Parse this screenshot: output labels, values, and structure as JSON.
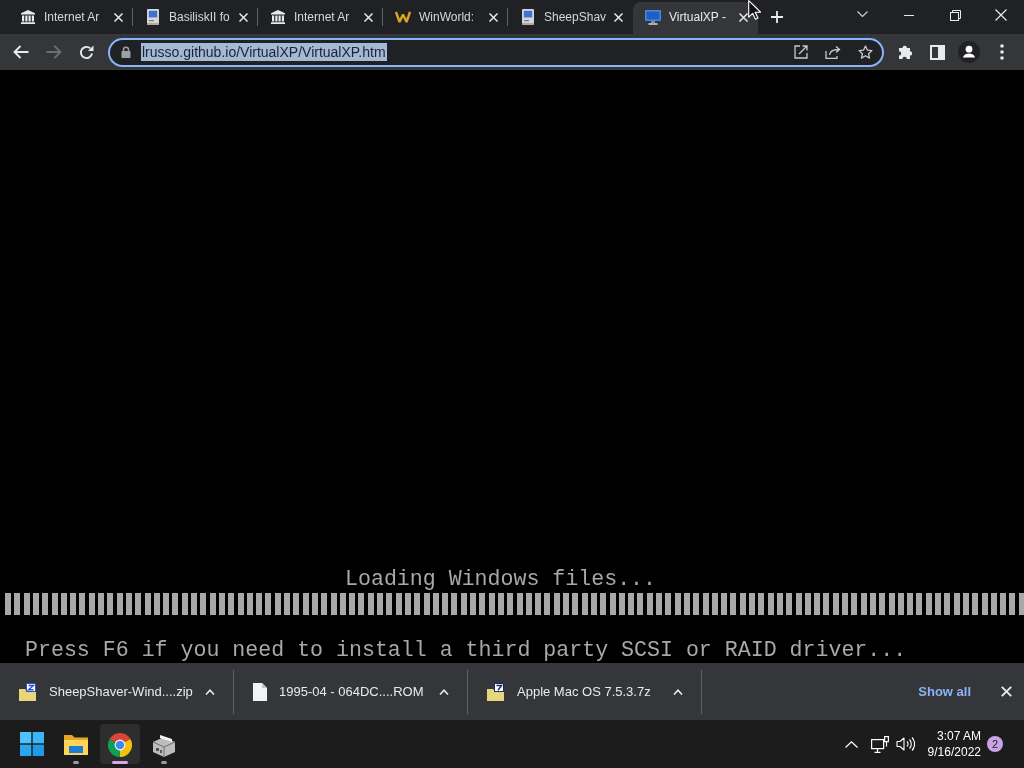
{
  "browser": {
    "tabs": [
      {
        "title": "Internet Ar",
        "kind": "archive",
        "selected": false
      },
      {
        "title": "BasiliskII fo",
        "kind": "mac",
        "selected": false
      },
      {
        "title": "Internet Ar",
        "kind": "archive",
        "selected": false
      },
      {
        "title": "WinWorld:",
        "kind": "winworld",
        "selected": false
      },
      {
        "title": "SheepShav",
        "kind": "mac",
        "selected": false
      },
      {
        "title": "VirtualXP -",
        "kind": "monitor",
        "selected": true
      }
    ],
    "toolbar": {
      "forward_disabled": true,
      "url": "lrusso.github.io/VirtualXP/VirtualXP.htm",
      "url_selected": true
    }
  },
  "page": {
    "status_text": "Loading Windows files...",
    "prompt": "Press F6 if you need to install a third party SCSI or RAID driver..."
  },
  "downloads": {
    "items": [
      {
        "name": "SheepShaver-Wind....zip",
        "kind": "zip"
      },
      {
        "name": "1995-04 - 064DC....ROM",
        "kind": "file"
      },
      {
        "name": "Apple Mac OS 7.5.3.7z",
        "kind": "sevenzip"
      }
    ],
    "show_all": "Show all"
  },
  "taskbar": {
    "apps": [
      {
        "kind": "explorer",
        "selected": false,
        "running": true
      },
      {
        "kind": "chrome",
        "selected": true,
        "running": true
      },
      {
        "kind": "package",
        "selected": false,
        "running": true
      }
    ],
    "time": "3:07 AM",
    "date": "9/16/2022",
    "notification_count": "2"
  }
}
